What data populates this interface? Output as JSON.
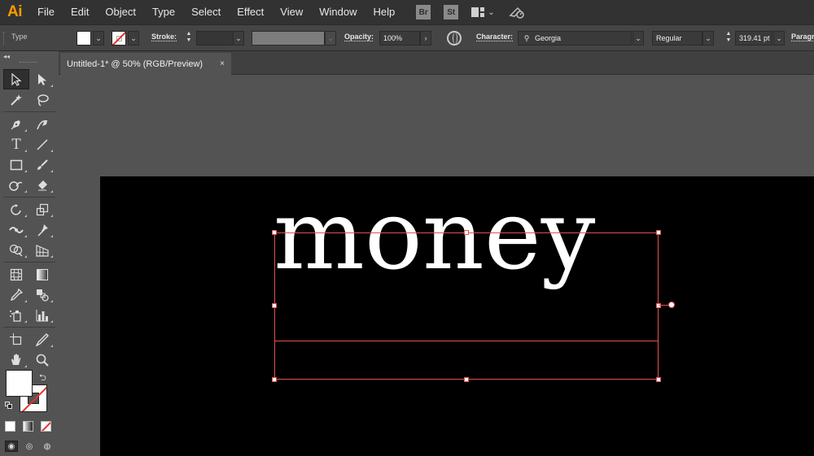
{
  "app": {
    "logo_text": "Ai"
  },
  "menu": [
    "File",
    "Edit",
    "Object",
    "Type",
    "Select",
    "Effect",
    "View",
    "Window",
    "Help"
  ],
  "app_icons": {
    "bridge": "Br",
    "stock": "St"
  },
  "control_bar": {
    "context_label": "Type",
    "stroke_label": "Stroke:",
    "opacity_label": "Opacity:",
    "opacity_value": "100%",
    "character_label": "Character:",
    "font_family": "Georgia",
    "font_style": "Regular",
    "font_size": "319.41 pt",
    "paragraph_label": "Paragraph",
    "fill_color": "#ffffff",
    "stroke_color": "none"
  },
  "document": {
    "tab_title": "Untitled-1* @ 50% (RGB/Preview)",
    "close_glyph": "×"
  },
  "canvas": {
    "text": "money",
    "artboard_color": "#000000",
    "text_color": "#ffffff",
    "selection_color": "#e25050"
  },
  "tools": [
    [
      "selection-tool",
      "direct-selection-tool"
    ],
    [
      "magic-wand-tool",
      "lasso-tool"
    ],
    [
      "pen-tool",
      "curvature-tool"
    ],
    [
      "type-tool",
      "line-segment-tool"
    ],
    [
      "rectangle-tool",
      "paintbrush-tool"
    ],
    [
      "shaper-tool",
      "eraser-tool"
    ],
    [
      "rotate-tool",
      "scale-tool"
    ],
    [
      "width-tool",
      "puppet-warp-tool"
    ],
    [
      "shape-builder-tool",
      "perspective-grid-tool"
    ],
    [
      "mesh-tool",
      "gradient-tool"
    ],
    [
      "eyedropper-tool",
      "blend-tool"
    ],
    [
      "symbol-sprayer-tool",
      "column-graph-tool"
    ],
    [
      "artboard-tool",
      "slice-tool"
    ],
    [
      "hand-tool",
      "zoom-tool"
    ]
  ]
}
